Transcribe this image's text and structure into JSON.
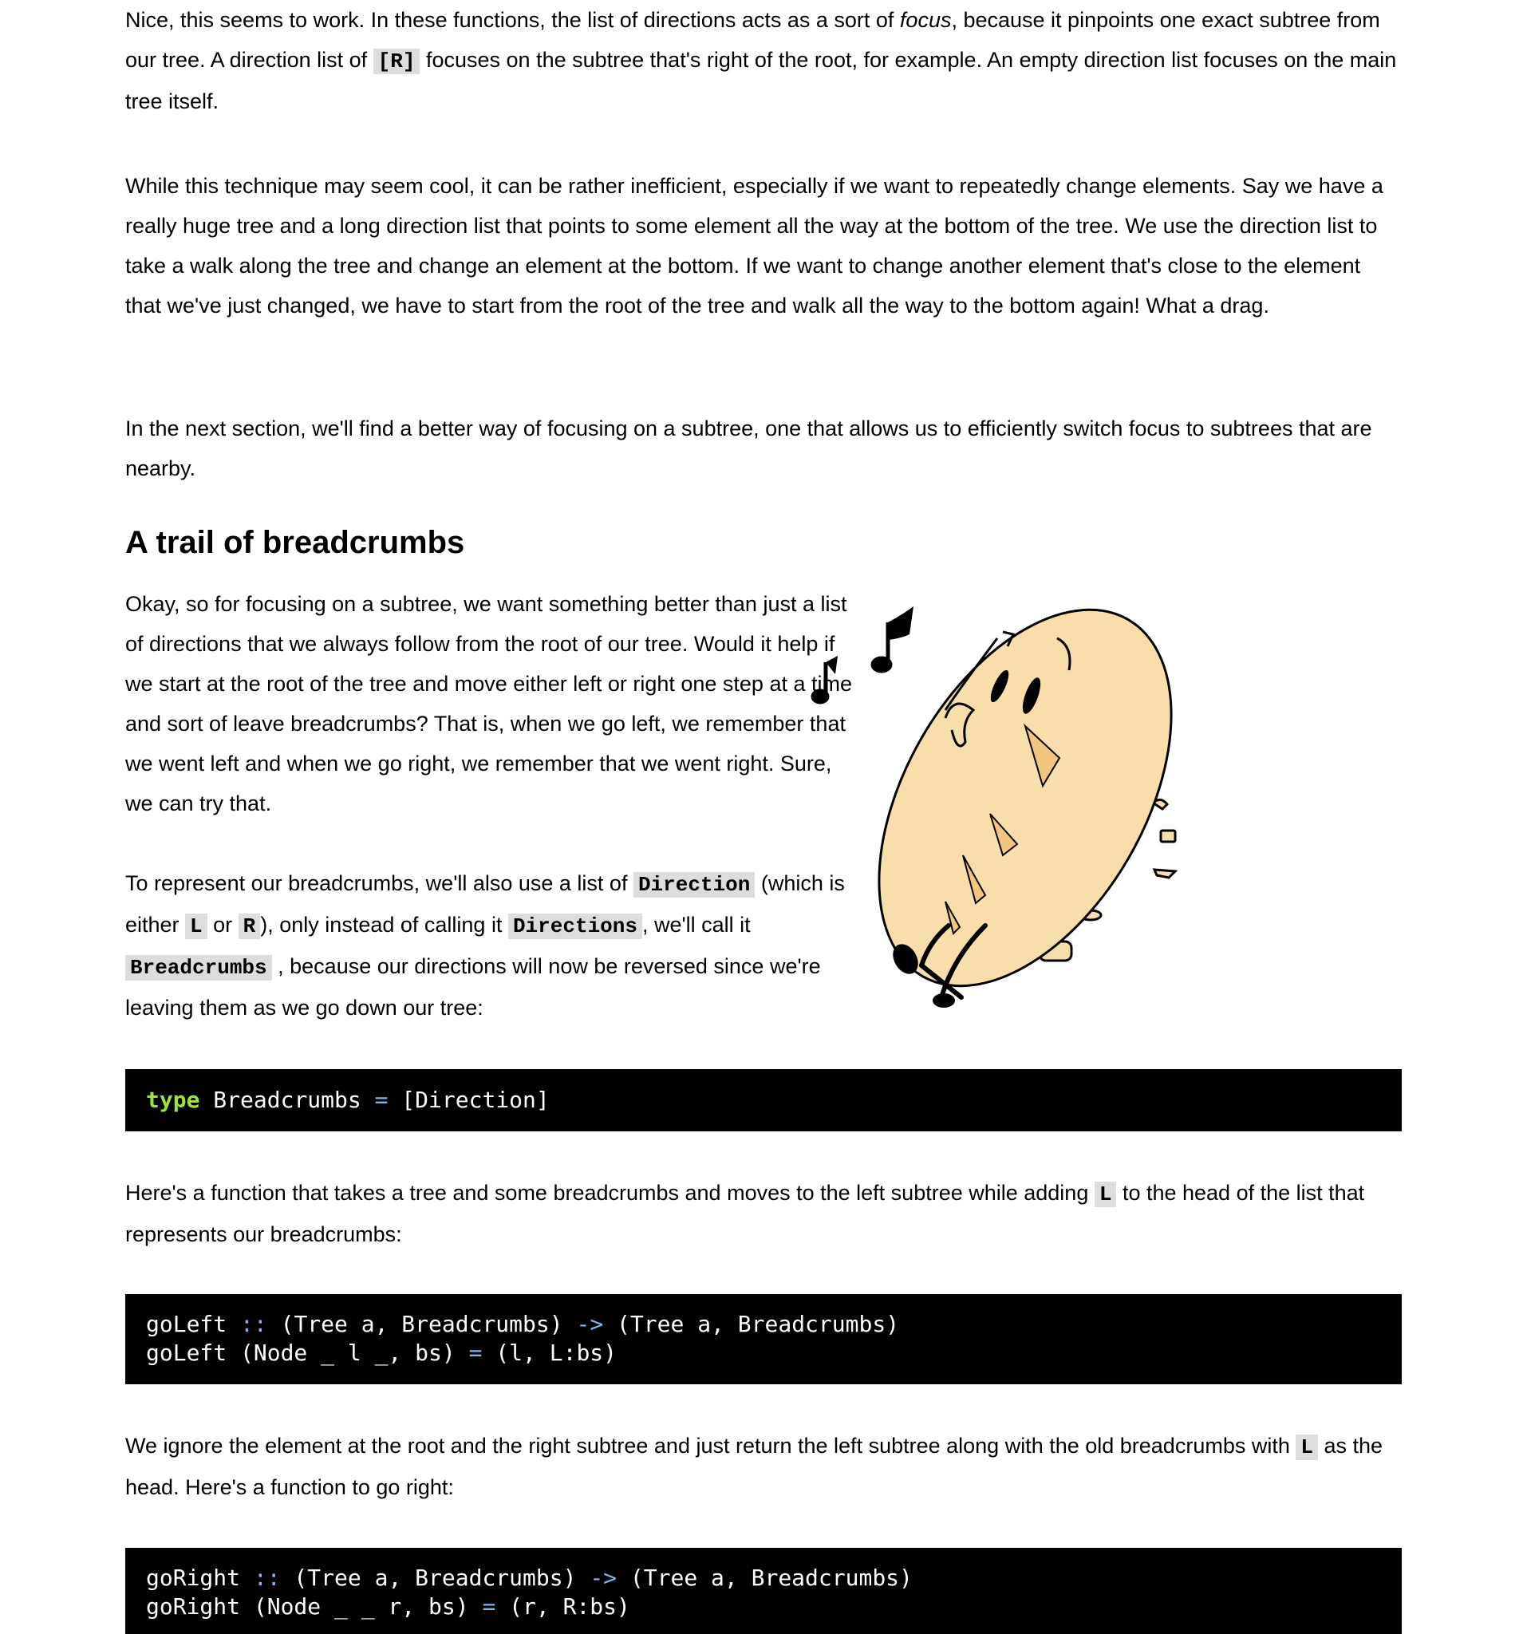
{
  "paragraphs": {
    "p1": {
      "a": "Nice, this seems to work. In these functions, the list of directions acts as a sort of ",
      "em": "focus",
      "b": ", because it pinpoints one exact subtree from our tree. A direction list of ",
      "code": "[R]",
      "c": " focuses on the subtree that's right of the root, for example. An empty direction list focuses on the main tree itself."
    },
    "p2": "While this technique may seem cool, it can be rather inefficient, especially if we want to repeatedly change elements. Say we have a really huge tree and a long direction list that points to some element all the way at the bottom of the tree. We use the direction list to take a walk along the tree and change an element at the bottom. If we want to change another element that's close to the element that we've just changed, we have to start from the root of the tree and walk all the way to the bottom again! What a drag.",
    "p3": "In the next section, we'll find a better way of focusing on a subtree, one that allows us to efficiently switch focus to subtrees that are nearby.",
    "p4": "Okay, so for focusing on a subtree, we want something better than just a list of directions that we always follow from the root of our tree. Would it help if we start at the root of the tree and move either left or right one step at a time and sort of leave breadcrumbs? That is, when we go left, we remember that we went left and when we go right, we remember that we went right. Sure, we can try that.",
    "p5": {
      "a": "To represent our breadcrumbs, we'll also use a list of ",
      "code1": "Direction",
      "b": " (which is either ",
      "code2": "L",
      "c": " or ",
      "code3": "R",
      "d": "), only instead of calling it ",
      "code4": "Directions",
      "e": ", we'll call it ",
      "code5": "Breadcrumbs",
      "f": " , because our directions will now be reversed since we're leaving them as we go down our tree:"
    },
    "p6": {
      "a": "Here's a function that takes a tree and some breadcrumbs and moves to the left subtree while adding ",
      "code": "L",
      "b": " to the head of the list that represents our breadcrumbs:"
    },
    "p7": {
      "a": "We ignore the element at the root and the right subtree and just return the left subtree along with the old breadcrumbs with ",
      "code": "L",
      "b": " as the head. Here's a function to go right:"
    }
  },
  "heading": "A trail of breadcrumbs",
  "code_blocks": {
    "type_decl": {
      "kw": "type",
      "rest1": " Breadcrumbs ",
      "eq": "=",
      "rest2": " [Direction]"
    },
    "goLeft": {
      "l1a": "goLeft ",
      "l1op1": "::",
      "l1b": " (Tree a, Breadcrumbs) ",
      "l1op2": "->",
      "l1c": " (Tree a, Breadcrumbs)",
      "l2a": "goLeft (Node _ l _, bs) ",
      "l2op": "=",
      "l2b": " (l, L:bs)"
    },
    "goRight": {
      "l1a": "goRight ",
      "l1op1": "::",
      "l1b": " (Tree a, Breadcrumbs) ",
      "l1op2": "->",
      "l1c": " (Tree a, Breadcrumbs)",
      "l2a": "goRight (Node _ _ r, bs) ",
      "l2op": "=",
      "l2b": " (r, R:bs)"
    }
  },
  "illustration": {
    "icon": "bread-character-illustration",
    "fill": "#f8deaa"
  }
}
